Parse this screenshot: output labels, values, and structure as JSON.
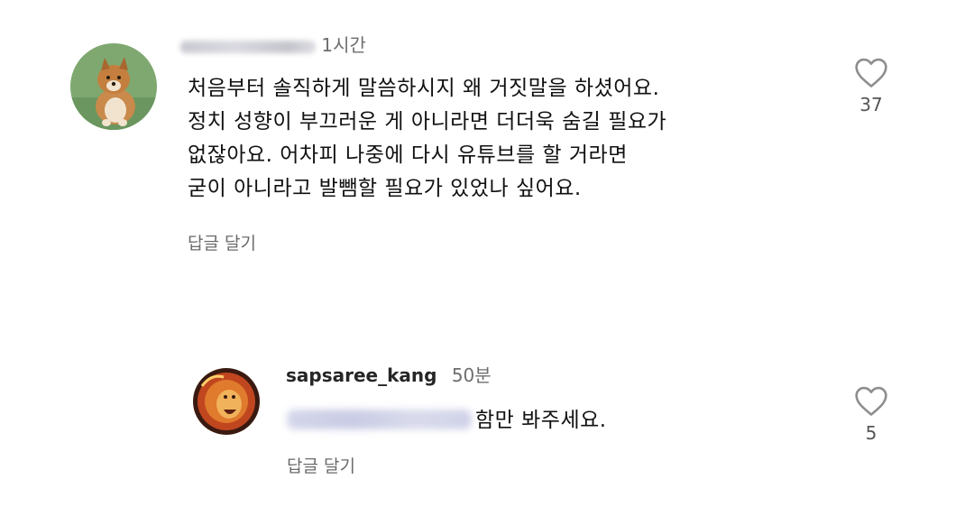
{
  "comment1": {
    "time": "1시간",
    "lines": [
      "처음부터 솔직하게 말씀하시지 왜 거짓말을 하셨어요.",
      "정치 성향이 부끄러운 게 아니라면 더더욱 숨길 필요가",
      "없잖아요.  어차피 나중에 다시 유튜브를 할 거라면",
      "굳이 아니라고 발뺌할 필요가 있었나 싶어요."
    ],
    "reply_label": "답글 달기",
    "like_count": "37",
    "avatar_icon": "puppy-avatar"
  },
  "comment2": {
    "username": "sapsaree_kang",
    "time": "50분",
    "text_after_mention": "함만 봐주세요.",
    "reply_label": "답글 달기",
    "like_count": "5",
    "avatar_icon": "lion-avatar"
  },
  "colors": {
    "text": "#111111",
    "meta": "#6e6e6e",
    "icon": "#8e8e8e"
  }
}
